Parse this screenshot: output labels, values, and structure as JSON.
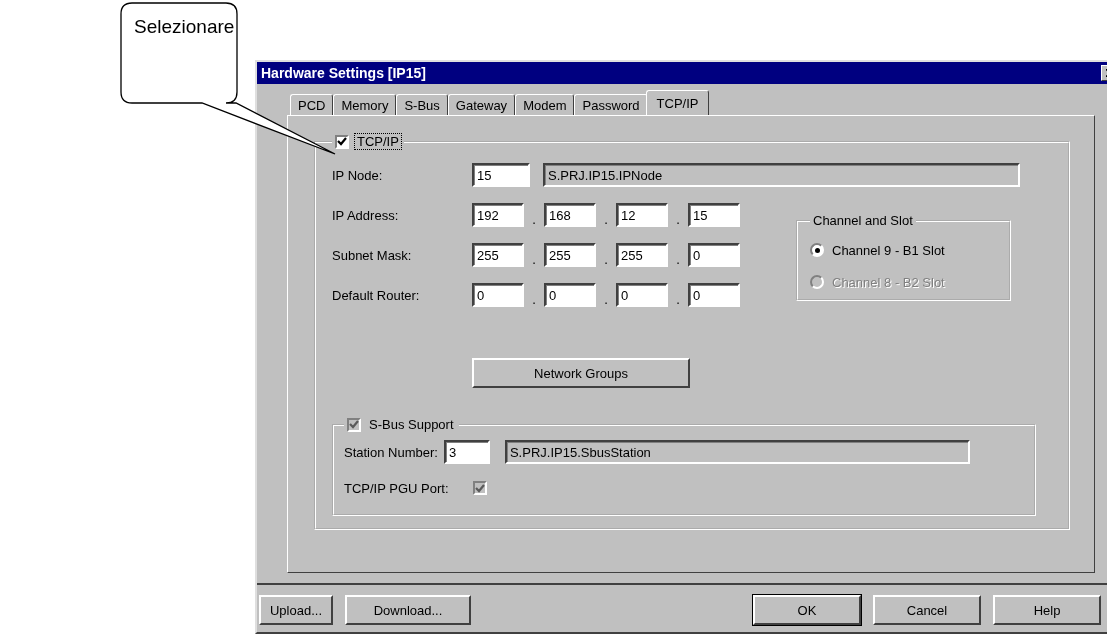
{
  "callout": {
    "text": "Selezionare"
  },
  "window": {
    "title": "Hardware Settings [IP15]"
  },
  "tabs": [
    {
      "label": "PCD",
      "selected": false
    },
    {
      "label": "Memory",
      "selected": false
    },
    {
      "label": "S-Bus",
      "selected": false
    },
    {
      "label": "Gateway",
      "selected": false
    },
    {
      "label": "Modem",
      "selected": false
    },
    {
      "label": "Password",
      "selected": false
    },
    {
      "label": "TCP/IP",
      "selected": true
    }
  ],
  "tcpip_group": {
    "label": "TCP/IP",
    "checked": true,
    "focused": true
  },
  "node_row": {
    "label": "IP Node:",
    "value": "15",
    "symbol": "S.PRJ.IP15.IPNode"
  },
  "address_rows": [
    {
      "label": "IP Address:",
      "parts": [
        {
          "kind": "octet",
          "value": "192"
        },
        {
          "kind": "dot",
          "text": "."
        },
        {
          "kind": "octet",
          "value": "168"
        },
        {
          "kind": "dot",
          "text": "."
        },
        {
          "kind": "octet",
          "value": "12"
        },
        {
          "kind": "dot",
          "text": "."
        },
        {
          "kind": "octet",
          "value": "15"
        }
      ]
    },
    {
      "label": "Subnet Mask:",
      "parts": [
        {
          "kind": "octet",
          "value": "255"
        },
        {
          "kind": "dot",
          "text": "."
        },
        {
          "kind": "octet",
          "value": "255"
        },
        {
          "kind": "dot",
          "text": "."
        },
        {
          "kind": "octet",
          "value": "255"
        },
        {
          "kind": "dot",
          "text": "."
        },
        {
          "kind": "octet",
          "value": "0"
        }
      ]
    },
    {
      "label": "Default Router:",
      "parts": [
        {
          "kind": "octet",
          "value": "0"
        },
        {
          "kind": "dot",
          "text": "."
        },
        {
          "kind": "octet",
          "value": "0"
        },
        {
          "kind": "dot",
          "text": "."
        },
        {
          "kind": "octet",
          "value": "0"
        },
        {
          "kind": "dot",
          "text": "."
        },
        {
          "kind": "octet",
          "value": "0"
        }
      ]
    }
  ],
  "network_groups_button": {
    "label": "Network Groups"
  },
  "channel_group": {
    "title": "Channel and Slot",
    "options": [
      {
        "label": "Channel 9 - B1 Slot",
        "selected": true,
        "disabled": false
      },
      {
        "label": "Channel 8 - B2 Slot",
        "selected": false,
        "disabled": true
      }
    ]
  },
  "sbus_group": {
    "label": "S-Bus Support",
    "checked": true,
    "disabled": true,
    "station": {
      "label": "Station Number:",
      "value": "3",
      "symbol": "S.PRJ.IP15.SbusStation"
    },
    "pgu_port": {
      "label": "TCP/IP PGU Port:",
      "checked": true,
      "disabled": true
    }
  },
  "buttons": [
    {
      "label": "Upload...",
      "kind": "left",
      "default": false
    },
    {
      "label": "Download...",
      "kind": "left",
      "default": false
    },
    {
      "label": "OK",
      "kind": "right",
      "default": true
    },
    {
      "label": "Cancel",
      "kind": "right",
      "default": false
    },
    {
      "label": "Help",
      "kind": "right",
      "default": false
    }
  ]
}
